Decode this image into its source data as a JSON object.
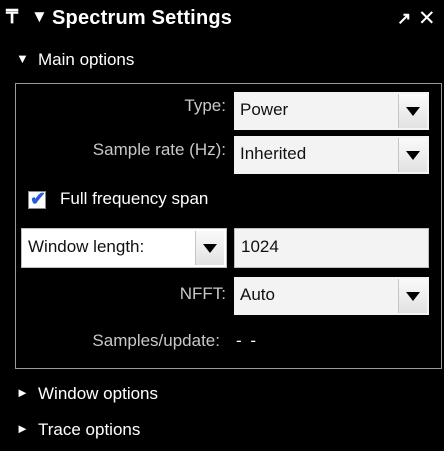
{
  "titlebar": {
    "pin_glyph": "₸",
    "collapse_glyph": "▼",
    "title": "Spectrum Settings",
    "undock_glyph": "↗",
    "close_glyph": "✕"
  },
  "sections": {
    "main": {
      "arrow": "▼",
      "label": "Main options"
    },
    "window": {
      "arrow": "►",
      "label": "Window options"
    },
    "trace": {
      "arrow": "►",
      "label": "Trace options"
    }
  },
  "main": {
    "type": {
      "label": "Type:",
      "value": "Power"
    },
    "sample_rate": {
      "label": "Sample rate (Hz):",
      "value": "Inherited"
    },
    "full_span": {
      "label": "Full frequency span",
      "checked": true
    },
    "window_length": {
      "selector": "Window length:",
      "value": "1024"
    },
    "nfft": {
      "label": "NFFT:",
      "value": "Auto"
    },
    "samples_update": {
      "label": "Samples/update:",
      "value": "- -"
    }
  },
  "colors": {
    "background": "#000000",
    "text": "#ffffff",
    "muted_text": "#c8c8c8",
    "field_bg": "#f3f3f3",
    "checkmark": "#2a5bd7"
  }
}
